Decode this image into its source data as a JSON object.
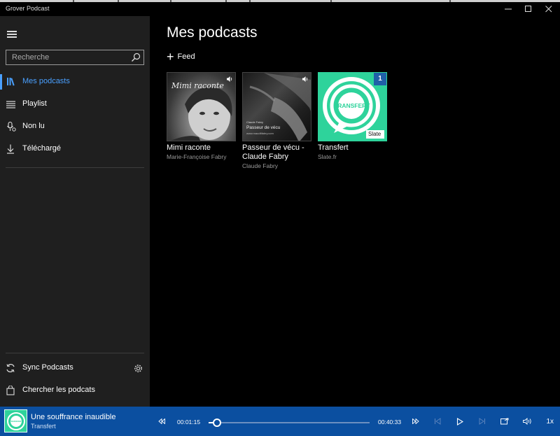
{
  "window": {
    "title": "Grover Podcast"
  },
  "sidebar": {
    "search_placeholder": "Recherche",
    "nav": [
      {
        "label": "Mes podcasts",
        "icon": "library-icon",
        "active": true
      },
      {
        "label": "Playlist",
        "icon": "playlist-icon",
        "active": false
      },
      {
        "label": "Non lu",
        "icon": "unread-icon",
        "active": false
      },
      {
        "label": "Téléchargé",
        "icon": "download-icon",
        "active": false
      }
    ],
    "bottom": [
      {
        "label": "Sync Podcasts",
        "icon": "sync-icon"
      },
      {
        "label": "Chercher les podcats",
        "icon": "search-podcasts-icon"
      }
    ]
  },
  "main": {
    "title": "Mes podcasts",
    "add_feed_label": "Feed",
    "podcasts": [
      {
        "title": "Mimi raconte",
        "author": "Marie-Françoise Fabry",
        "art_text": "Mimi raconte"
      },
      {
        "title": "Passeur de vécu - Claude Fabry",
        "author": "Claude Fabry",
        "art_text_small": "Claude Fabry",
        "art_text": "Passeur de vécu",
        "art_url_text": "www.mauditfabry.com"
      },
      {
        "title": "Transfert",
        "author": "Slate.fr",
        "art_text": "TRANSFERT",
        "art_brand": "Slate",
        "badge": "1"
      }
    ]
  },
  "player": {
    "episode_title": "Une souffrance inaudible",
    "podcast": "Transfert",
    "thumb_text": "TRANSFERT",
    "elapsed": "00:01:15",
    "duration": "00:40:33",
    "speed": "1x",
    "progress": 0.031
  },
  "colors": {
    "accent": "#4aa0ff",
    "player_bg": "#0b4fa0",
    "sidebar_bg": "#1f1f1f",
    "transfert_green": "#2ed39b"
  }
}
